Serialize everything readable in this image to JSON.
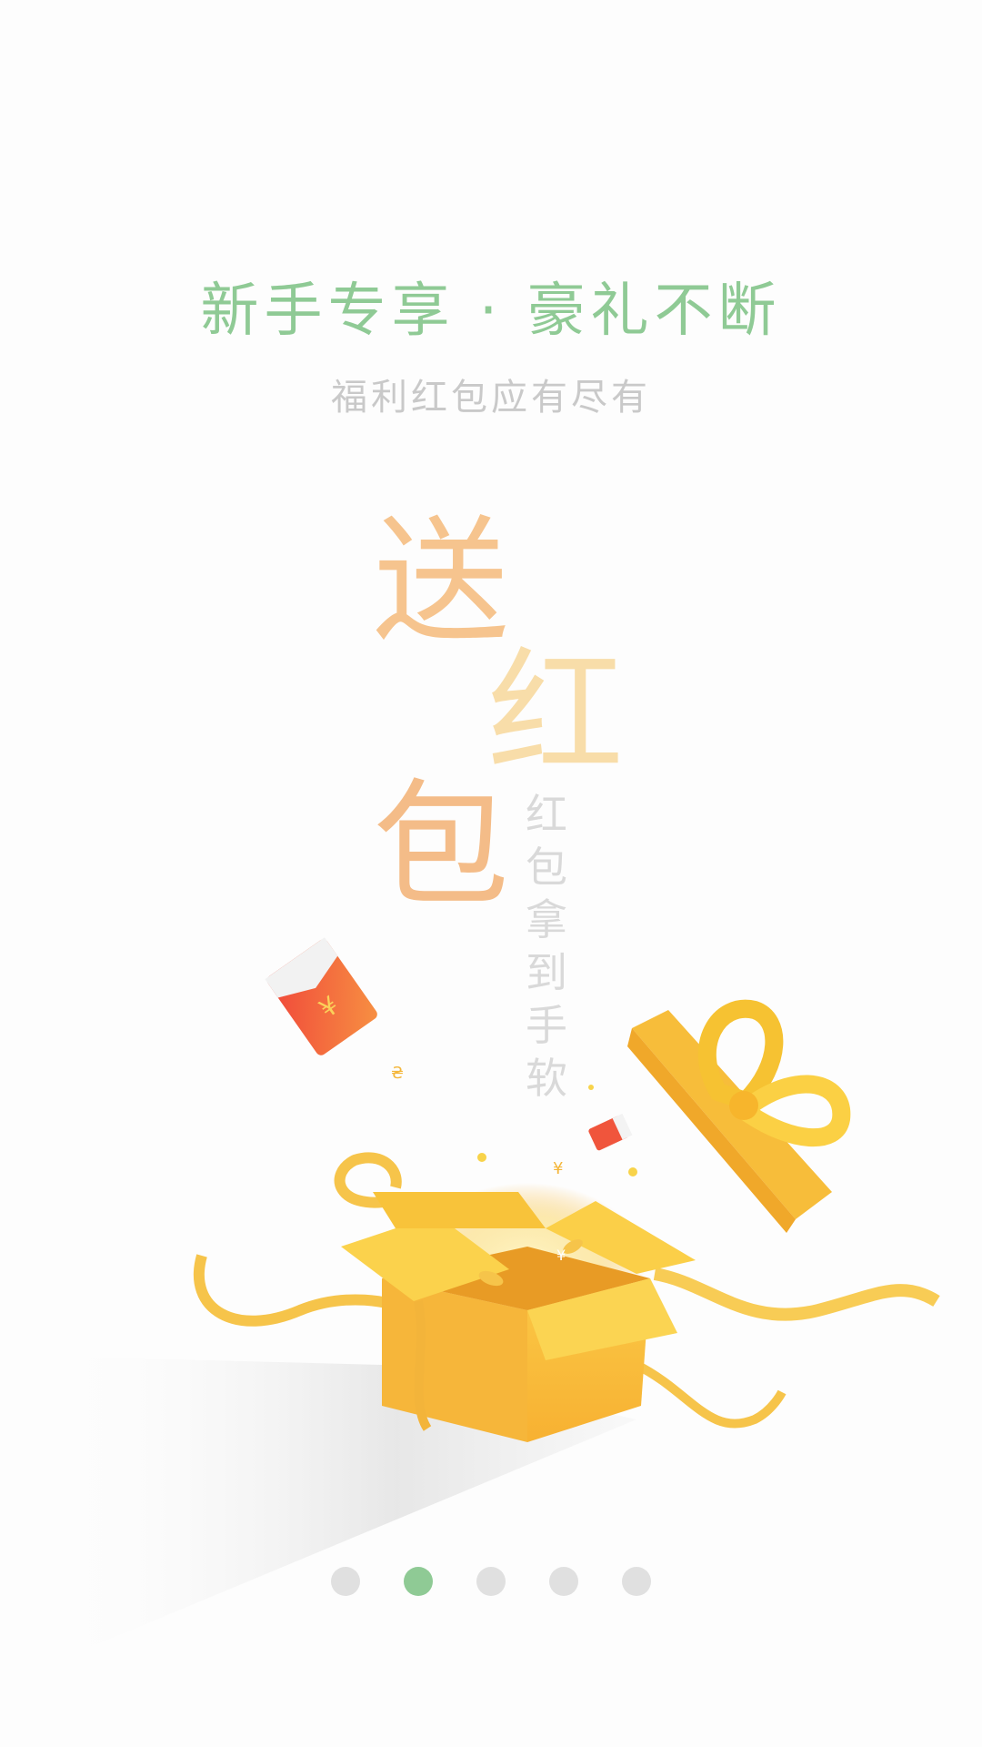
{
  "headline": "新手专享 · 豪礼不断",
  "subline": "福利红包应有尽有",
  "big_text": [
    "送",
    "红",
    "包"
  ],
  "vertical_note": "红包拿到手软",
  "icons": {
    "red_envelope": "red-envelope-icon",
    "gift_box": "gift-box-icon",
    "gift_lid": "gift-lid-bow-icon",
    "yuan_symbol": "¥"
  },
  "pager": {
    "total": 5,
    "active_index": 1
  },
  "colors": {
    "accent_green": "#8fca95",
    "subline_gray": "#c9c9c9",
    "gift_yellow": "#f8c63a",
    "envelope_red": "#f0553c",
    "dot_inactive": "#e0e0e0"
  }
}
